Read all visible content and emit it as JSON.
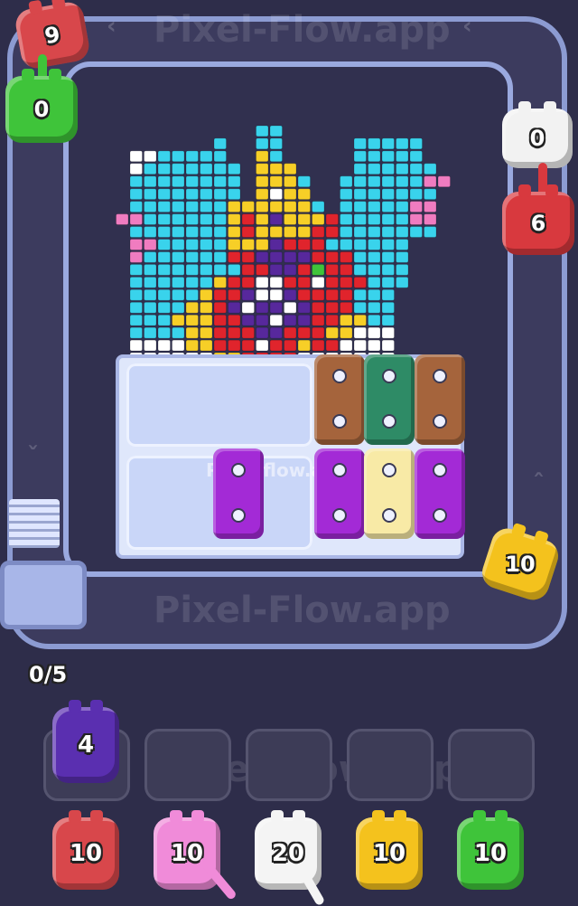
{
  "watermark": "Pixel-Flow.app",
  "tray_watermark": "Pixel-flow.app",
  "counter": "0/5",
  "track_chars": [
    {
      "id": "red-top-left",
      "color": "#d8474b",
      "count": "9"
    },
    {
      "id": "green-left",
      "color": "#3fc43a",
      "count": "0"
    },
    {
      "id": "white-right",
      "color": "#f2f2f2",
      "count": "0"
    },
    {
      "id": "red-right",
      "color": "#d8393e",
      "count": "6"
    },
    {
      "id": "yellow-right",
      "color": "#f4c21d",
      "count": "10"
    }
  ],
  "queue_front": {
    "color": "#5a2fb0",
    "count": "4"
  },
  "bottom_chars": [
    {
      "color": "#d8474b",
      "count": "10"
    },
    {
      "color": "#f08bd9",
      "count": "10"
    },
    {
      "color": "#f4f4f4",
      "count": "20"
    },
    {
      "color": "#f4c21d",
      "count": "10"
    },
    {
      "color": "#3fc43a",
      "count": "10"
    }
  ],
  "blocks": [
    {
      "color": "#a5643c",
      "col": 4,
      "row": 0
    },
    {
      "color": "#2e8b66",
      "col": 5,
      "row": 0
    },
    {
      "color": "#a5643c",
      "col": 6,
      "row": 0
    },
    {
      "color": "#a32ad6",
      "col": 2,
      "row": 1
    },
    {
      "color": "#a32ad6",
      "col": 4,
      "row": 1
    },
    {
      "color": "#f8eaa6",
      "col": 5,
      "row": 1
    },
    {
      "color": "#a32ad6",
      "col": 6,
      "row": 1
    }
  ],
  "palette": {
    "c": "#39d3ec",
    "w": "#ffffff",
    "y": "#f7cf27",
    "r": "#e0242c",
    "p": "#57289c",
    "k": "#f07cc0",
    "g": "#3fc43a",
    "o": "#f39c3b"
  },
  "pixel_art": [
    "..........................",
    "...........cc.............",
    "........c..cc.....ccccc...",
    "..wwccccc..yc.....ccccc...",
    "..wccccccc.yyy....cccccc..",
    "..cccccccc.yyyc..cccccckk.",
    "..cccccccc.ywyy..ccccccc..",
    "..cccccccyyyyyyc.ccccckk..",
    ".kkccccccyrypyyyrccccckk..",
    "..cccccccyryyyyrrccccccc..",
    "..kkcccccyyyprrrcccccc....",
    "..kccccccrrpppprrrcccc....",
    "..ccccccccrrpprgrrcccc....",
    "..ccccccyrrwwrrwrrrccc....",
    "..cccccyrrpwwprrrrccc.....",
    "..ccccyyrpwppwprrrccc.....",
    "..cccyyyrrppwpprryycc.....",
    "..ccccyyrrrpprrryywww.....",
    "..wwwwyyrrrwrryrrwwww.....",
    "..wwwwwwyyrrrrwwwwwww....."
  ]
}
